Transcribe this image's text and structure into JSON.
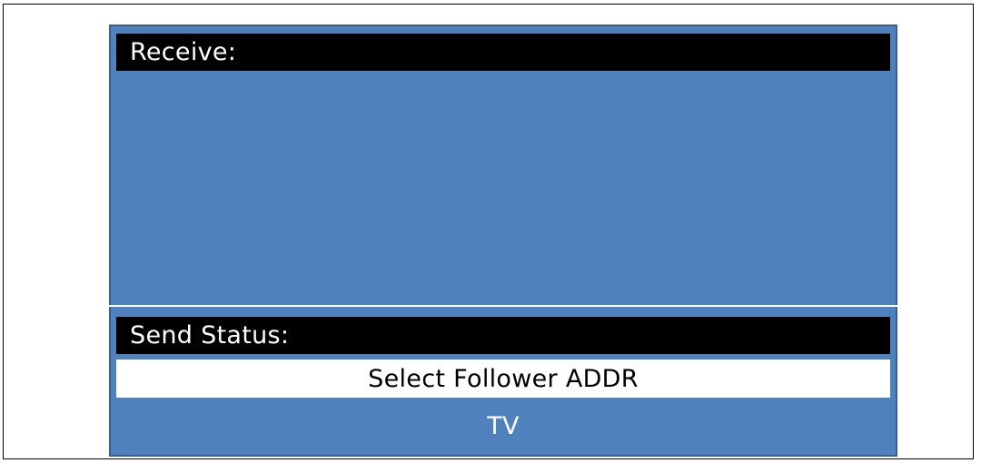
{
  "receive": {
    "label": "Receive:"
  },
  "send_status": {
    "label": "Send Status:",
    "message": "Select Follower ADDR"
  },
  "device": {
    "label": "TV"
  },
  "colors": {
    "screen_background": "#4f81bd",
    "header_background": "#000000",
    "header_text": "#ffffff",
    "status_background": "#ffffff"
  }
}
